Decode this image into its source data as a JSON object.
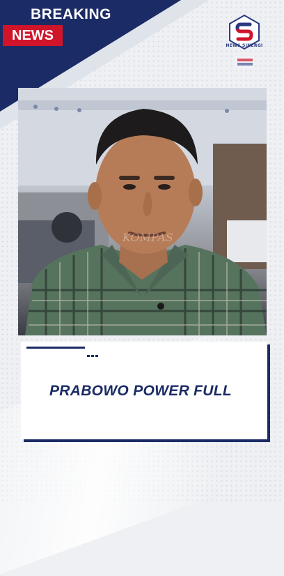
{
  "banner": {
    "breaking": "BREAKING",
    "news": "NEWS"
  },
  "logo": {
    "text": "NEWS SINERGI"
  },
  "video": {
    "watermark": "KOMPAS"
  },
  "caption": {
    "headline": "PRABOWO POWER FULL"
  },
  "colors": {
    "navy": "#1b2b66",
    "red": "#d0142a"
  }
}
